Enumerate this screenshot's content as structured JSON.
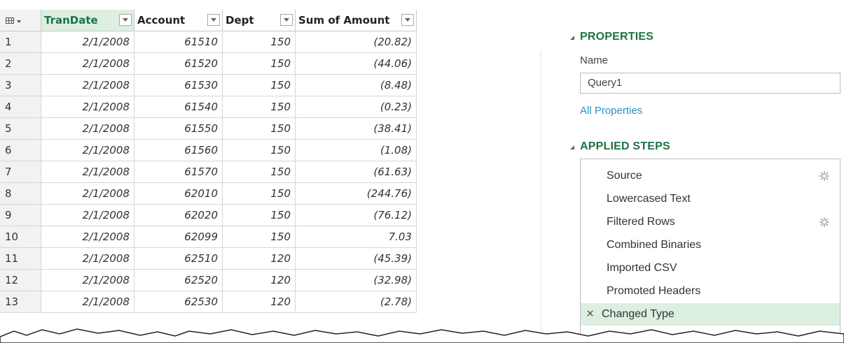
{
  "grid": {
    "columns": [
      {
        "label": "TranDate"
      },
      {
        "label": "Account"
      },
      {
        "label": "Dept"
      },
      {
        "label": "Sum of Amount"
      }
    ],
    "rows": [
      {
        "n": "1",
        "date": "2/1/2008",
        "account": "61510",
        "dept": "150",
        "amount": "(20.82)"
      },
      {
        "n": "2",
        "date": "2/1/2008",
        "account": "61520",
        "dept": "150",
        "amount": "(44.06)"
      },
      {
        "n": "3",
        "date": "2/1/2008",
        "account": "61530",
        "dept": "150",
        "amount": "(8.48)"
      },
      {
        "n": "4",
        "date": "2/1/2008",
        "account": "61540",
        "dept": "150",
        "amount": "(0.23)"
      },
      {
        "n": "5",
        "date": "2/1/2008",
        "account": "61550",
        "dept": "150",
        "amount": "(38.41)"
      },
      {
        "n": "6",
        "date": "2/1/2008",
        "account": "61560",
        "dept": "150",
        "amount": "(1.08)"
      },
      {
        "n": "7",
        "date": "2/1/2008",
        "account": "61570",
        "dept": "150",
        "amount": "(61.63)"
      },
      {
        "n": "8",
        "date": "2/1/2008",
        "account": "62010",
        "dept": "150",
        "amount": "(244.76)"
      },
      {
        "n": "9",
        "date": "2/1/2008",
        "account": "62020",
        "dept": "150",
        "amount": "(76.12)"
      },
      {
        "n": "10",
        "date": "2/1/2008",
        "account": "62099",
        "dept": "150",
        "amount": "7.03"
      },
      {
        "n": "11",
        "date": "2/1/2008",
        "account": "62510",
        "dept": "120",
        "amount": "(45.39)"
      },
      {
        "n": "12",
        "date": "2/1/2008",
        "account": "62520",
        "dept": "120",
        "amount": "(32.98)"
      },
      {
        "n": "13",
        "date": "2/1/2008",
        "account": "62530",
        "dept": "120",
        "amount": "(2.78)"
      }
    ]
  },
  "pane": {
    "properties_header": "PROPERTIES",
    "name_label": "Name",
    "name_value": "Query1",
    "all_properties_link": "All Properties",
    "applied_steps_header": "APPLIED STEPS",
    "steps": [
      {
        "label": "Source",
        "gear": true
      },
      {
        "label": "Lowercased Text",
        "gear": false
      },
      {
        "label": "Filtered Rows",
        "gear": true
      },
      {
        "label": "Combined Binaries",
        "gear": false
      },
      {
        "label": "Imported CSV",
        "gear": false
      },
      {
        "label": "Promoted Headers",
        "gear": false
      },
      {
        "label": "Changed Type",
        "gear": false,
        "selected": true
      }
    ]
  },
  "colors": {
    "accent_green": "#1e7145",
    "selected_bg": "#dcefe1",
    "link_blue": "#2b8fc7"
  }
}
